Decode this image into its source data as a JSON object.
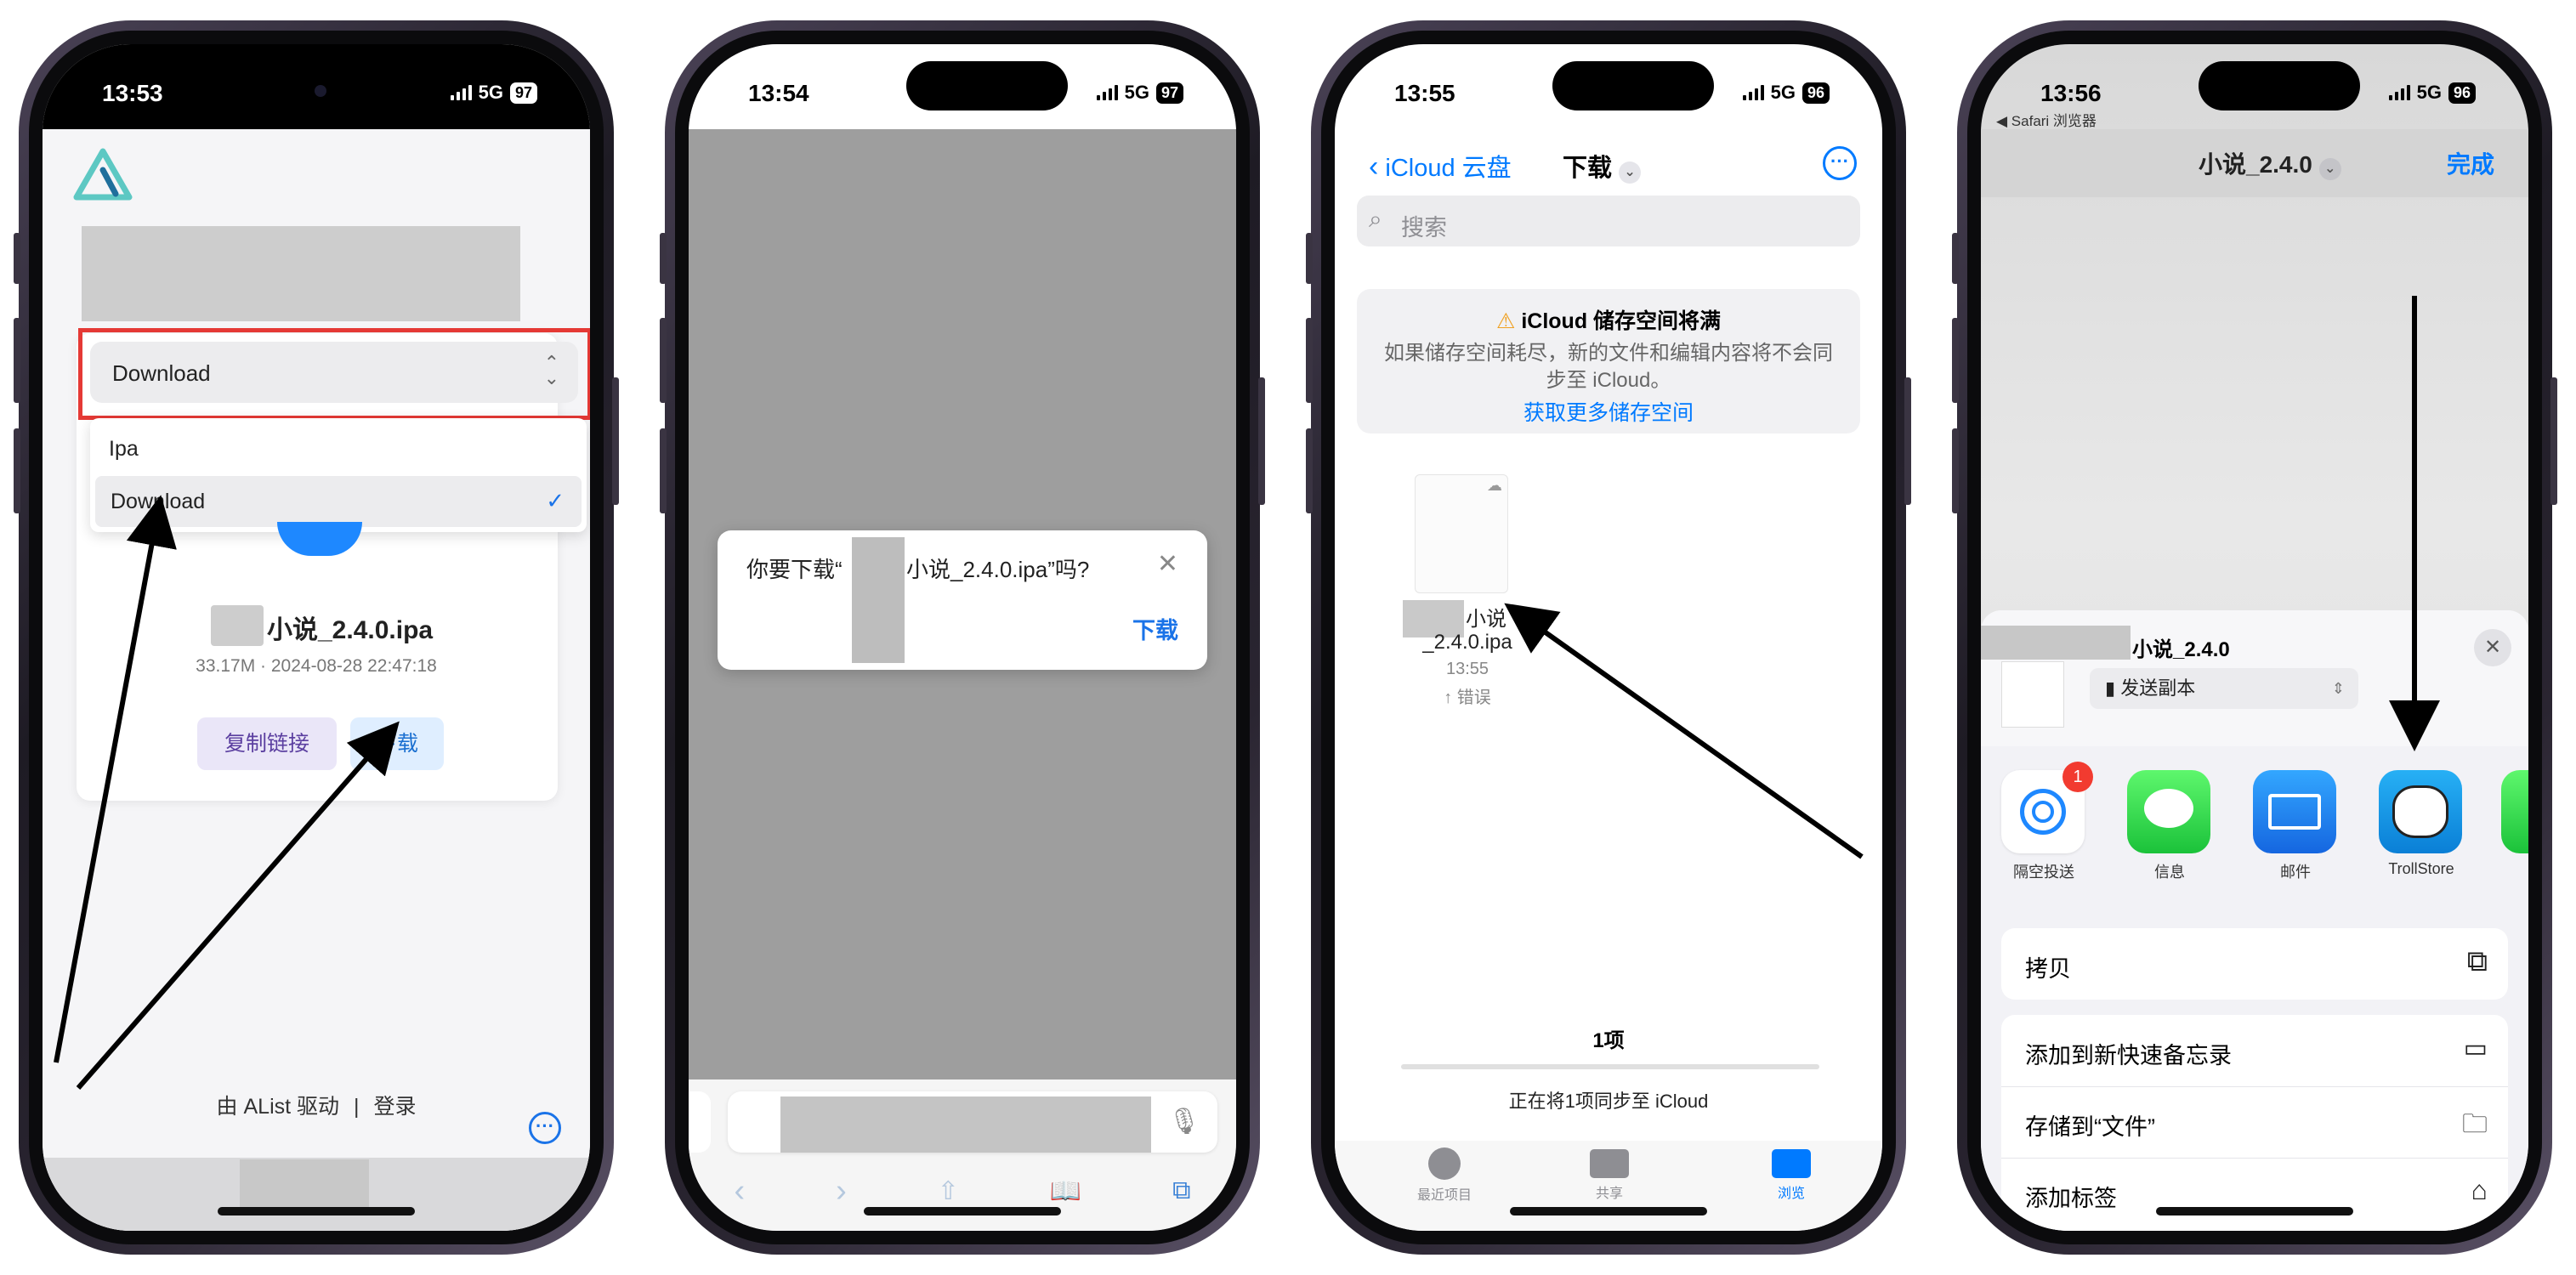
{
  "phone1": {
    "time": "13:53",
    "network": "5G",
    "battery": "97",
    "select_value": "Download",
    "options": [
      "Ipa",
      "Download"
    ],
    "file_name": "小说_2.4.0.ipa",
    "file_meta": "33.17M · 2024-08-28 22:47:18",
    "copy_link_label": "复制链接",
    "download_label": "下载",
    "footer_powered": "由 AList 驱动",
    "footer_separator": "|",
    "footer_login": "登录"
  },
  "phone2": {
    "time": "13:54",
    "network": "5G",
    "battery": "97",
    "dialog_prefix": "你要下载“",
    "dialog_suffix": "小说_2.4.0.ipa”吗?",
    "dialog_download": "下载"
  },
  "phone3": {
    "time": "13:55",
    "network": "5G",
    "battery": "96",
    "back_label": "iCloud 云盘",
    "title": "下载",
    "search_placeholder": "搜索",
    "banner_title": "iCloud 储存空间将满",
    "banner_body": "如果储存空间耗尽，新的文件和编辑内容将不会同步至 iCloud。",
    "banner_link": "获取更多储存空间",
    "file_label_line1": "小说",
    "file_label_line2": "_2.4.0.ipa",
    "file_time": "13:55",
    "file_status": "↑ 错误",
    "count_label": "1项",
    "sync_label": "正在将1项同步至 iCloud",
    "tabs": [
      "最近项目",
      "共享",
      "浏览"
    ]
  },
  "phone4": {
    "time": "13:56",
    "back_app": "◀ Safari 浏览器",
    "network": "5G",
    "battery": "96",
    "title": "小说_2.4.0",
    "done_label": "完成",
    "bg_title": "汪汲小说 2.4.0",
    "share_title": "小说_2.4.0",
    "share_mode": "发送副本",
    "apps": [
      {
        "label": "隔空投送",
        "badge": "1"
      },
      {
        "label": "信息"
      },
      {
        "label": "邮件"
      },
      {
        "label": "TrollStore"
      }
    ],
    "actions": [
      "拷贝",
      "添加到新快速备忘录",
      "存储到“文件”",
      "添加标签"
    ]
  },
  "colors": {
    "accent_blue": "#007aff",
    "highlight_red": "#e53935",
    "alist_teal": "#5dc8c3"
  }
}
